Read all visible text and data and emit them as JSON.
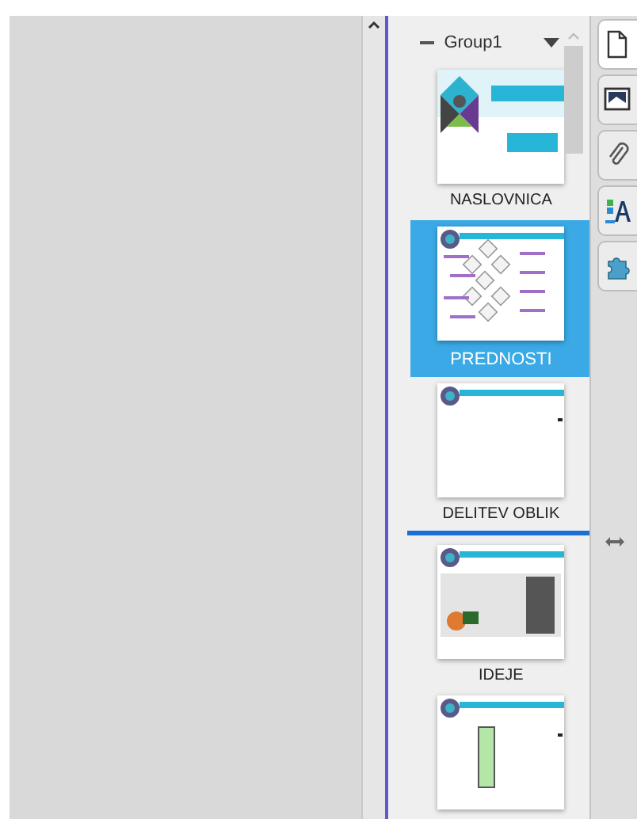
{
  "group": {
    "name": "Group1",
    "expanded": true
  },
  "slides": [
    {
      "kind": "title",
      "label": "NASLOVNICA",
      "selected": false,
      "drop_after": false
    },
    {
      "kind": "diagram",
      "label": "PREDNOSTI",
      "selected": true,
      "drop_after": false
    },
    {
      "kind": "blank",
      "label": "DELITEV OBLIK",
      "selected": false,
      "drop_after": true
    },
    {
      "kind": "image",
      "label": "IDEJE",
      "selected": false,
      "drop_after": false
    },
    {
      "kind": "bar",
      "selected": false,
      "drop_after": false
    }
  ],
  "side_tabs": [
    {
      "kind": "page",
      "selected": true
    },
    {
      "kind": "gallery",
      "selected": false
    },
    {
      "kind": "attachment",
      "selected": false
    },
    {
      "kind": "properties",
      "selected": false
    },
    {
      "kind": "addon",
      "selected": false
    }
  ]
}
